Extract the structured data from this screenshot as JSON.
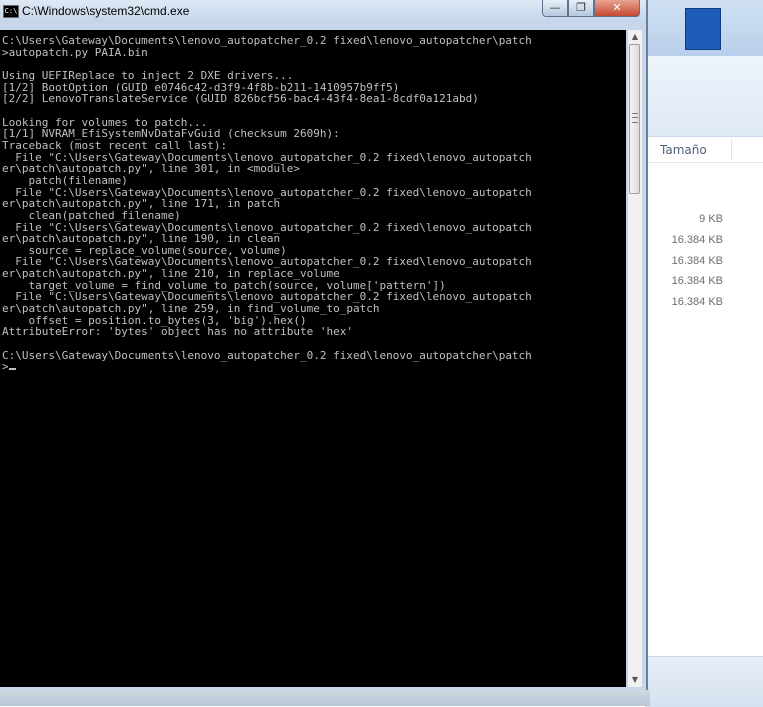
{
  "window": {
    "title": "C:\\Windows\\system32\\cmd.exe",
    "icon_text": "C:\\",
    "minimize_symbol": "—",
    "maximize_symbol": "❐",
    "close_symbol": "✕"
  },
  "console": {
    "lines": [
      "C:\\Users\\Gateway\\Documents\\lenovo_autopatcher_0.2 fixed\\lenovo_autopatcher\\patch",
      ">autopatch.py PAIA.bin",
      "",
      "Using UEFIReplace to inject 2 DXE drivers...",
      "[1/2] BootOption (GUID e0746c42-d3f9-4f8b-b211-1410957b9ff5)",
      "[2/2] LenovoTranslateService (GUID 826bcf56-bac4-43f4-8ea1-8cdf0a121abd)",
      "",
      "Looking for volumes to patch...",
      "[1/1] NVRAM_EfiSystemNvDataFvGuid (checksum 2609h):",
      "Traceback (most recent call last):",
      "  File \"C:\\Users\\Gateway\\Documents\\lenovo_autopatcher_0.2 fixed\\lenovo_autopatch",
      "er\\patch\\autopatch.py\", line 301, in <module>",
      "    patch(filename)",
      "  File \"C:\\Users\\Gateway\\Documents\\lenovo_autopatcher_0.2 fixed\\lenovo_autopatch",
      "er\\patch\\autopatch.py\", line 171, in patch",
      "    clean(patched_filename)",
      "  File \"C:\\Users\\Gateway\\Documents\\lenovo_autopatcher_0.2 fixed\\lenovo_autopatch",
      "er\\patch\\autopatch.py\", line 190, in clean",
      "    source = replace_volume(source, volume)",
      "  File \"C:\\Users\\Gateway\\Documents\\lenovo_autopatcher_0.2 fixed\\lenovo_autopatch",
      "er\\patch\\autopatch.py\", line 210, in replace_volume",
      "    target_volume = find_volume_to_patch(source, volume['pattern'])",
      "  File \"C:\\Users\\Gateway\\Documents\\lenovo_autopatcher_0.2 fixed\\lenovo_autopatch",
      "er\\patch\\autopatch.py\", line 259, in find_volume_to_patch",
      "    offset = position.to_bytes(3, 'big').hex()",
      "AttributeError: 'bytes' object has no attribute 'hex'",
      "",
      "C:\\Users\\Gateway\\Documents\\lenovo_autopatcher_0.2 fixed\\lenovo_autopatcher\\patch",
      ">"
    ]
  },
  "scrollbar": {
    "up_arrow": "▲",
    "down_arrow": "▼"
  },
  "explorer": {
    "column_header": "Tamaño",
    "sizes": [
      "9 KB",
      "16.384 KB",
      "16.384 KB",
      "16.384 KB",
      "16.384 KB"
    ]
  },
  "colors": {
    "console_bg": "#000000",
    "console_fg": "#c0c0c0",
    "titlebar": "#c4d5ea",
    "close_button": "#c44a32"
  }
}
